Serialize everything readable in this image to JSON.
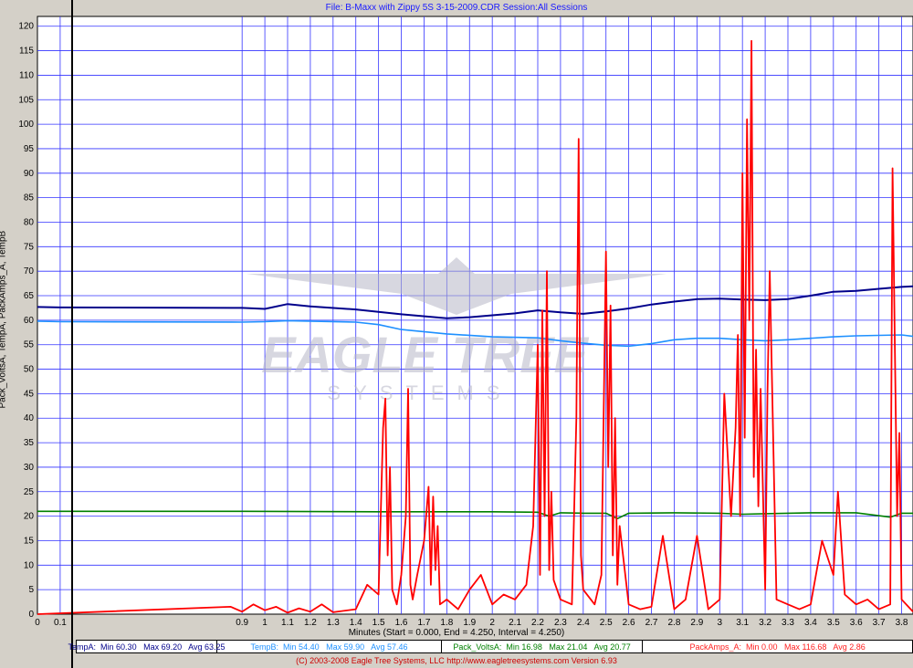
{
  "header": {
    "file_title": "File: B-Maxx with Zippy 5S 3-15-2009.CDR   Session:All Sessions"
  },
  "axes": {
    "ylabel": "Pack_VoltsA, TempA, PackAmps_A, TempB",
    "xlabel": "Minutes (Start = 0.000,  End = 4.250,  Interval = 4.250)"
  },
  "watermark": {
    "line1": "EAGLE TREE",
    "line2": "SYSTEMS"
  },
  "legend": {
    "tempA": "TempA:  Min 60.30   Max 69.20   Avg 63.25",
    "tempB": "TempB:  Min 54.40   Max 59.90   Avg 57.46",
    "volts": "Pack_VoltsA:  Min 16.98   Max 21.04   Avg 20.77",
    "amps": "PackAmps_A:  Min 0.00   Max 116.68   Avg 2.86"
  },
  "footer": {
    "copyright": "(C) 2003-2008 Eagle Tree Systems, LLC     http://www.eagletreesystems.com     Version 6.93"
  },
  "colors": {
    "tempA": "#00008b",
    "tempB": "#1e90ff",
    "volts": "#008000",
    "amps": "#ff0000",
    "grid": "#3333ff",
    "plot_bg": "#ffffff"
  },
  "chart_data": {
    "type": "line",
    "x_unit": "Minutes",
    "xlim": [
      0,
      3.85
    ],
    "ylim": [
      0,
      122
    ],
    "x_ticks": [
      "0",
      "0.1",
      "0.9",
      "1",
      "1.1",
      "1.2",
      "1.3",
      "1.4",
      "1.5",
      "1.6",
      "1.7",
      "1.8",
      "1.9",
      "2",
      "2.1",
      "2.2",
      "2.3",
      "2.4",
      "2.5",
      "2.6",
      "2.7",
      "2.8",
      "2.9",
      "3",
      "3.1",
      "3.2",
      "3.3",
      "3.4",
      "3.5",
      "3.6",
      "3.7",
      "3.8"
    ],
    "y_ticks": [
      0,
      5,
      10,
      15,
      20,
      25,
      30,
      35,
      40,
      45,
      50,
      55,
      60,
      65,
      70,
      75,
      80,
      85,
      90,
      95,
      100,
      105,
      110,
      115,
      120
    ],
    "series": [
      {
        "name": "TempA",
        "x": [
          0.0,
          0.1,
          0.9,
          1.0,
          1.1,
          1.2,
          1.4,
          1.6,
          1.8,
          1.9,
          2.0,
          2.1,
          2.2,
          2.3,
          2.4,
          2.5,
          2.6,
          2.7,
          2.8,
          2.9,
          3.0,
          3.1,
          3.2,
          3.3,
          3.4,
          3.5,
          3.6,
          3.7,
          3.8,
          3.85
        ],
        "y": [
          62.7,
          62.6,
          62.5,
          62.3,
          63.3,
          62.8,
          62.2,
          61.2,
          60.4,
          60.6,
          61.0,
          61.4,
          62.0,
          61.6,
          61.3,
          61.8,
          62.4,
          63.2,
          63.8,
          64.3,
          64.4,
          64.2,
          64.1,
          64.3,
          65.0,
          65.8,
          66.0,
          66.4,
          66.8,
          66.9
        ]
      },
      {
        "name": "TempB",
        "x": [
          0.0,
          0.1,
          0.9,
          1.0,
          1.1,
          1.2,
          1.4,
          1.5,
          1.6,
          1.8,
          2.0,
          2.2,
          2.3,
          2.4,
          2.5,
          2.6,
          2.7,
          2.8,
          2.9,
          3.0,
          3.1,
          3.2,
          3.3,
          3.4,
          3.5,
          3.6,
          3.7,
          3.8,
          3.85
        ],
        "y": [
          59.8,
          59.7,
          59.6,
          59.7,
          59.9,
          59.8,
          59.6,
          59.1,
          58.1,
          57.2,
          56.6,
          56.4,
          55.8,
          55.3,
          54.9,
          54.7,
          55.2,
          56.0,
          56.3,
          56.3,
          56.0,
          55.8,
          56.0,
          56.3,
          56.6,
          56.8,
          56.9,
          57.0,
          56.7
        ]
      },
      {
        "name": "Pack_VoltsA",
        "x": [
          0.0,
          0.9,
          1.5,
          2.0,
          2.2,
          2.25,
          2.3,
          2.4,
          2.5,
          2.55,
          2.6,
          2.8,
          3.0,
          3.1,
          3.2,
          3.4,
          3.6,
          3.75,
          3.8,
          3.85
        ],
        "y": [
          21.0,
          21.0,
          20.9,
          20.9,
          20.8,
          20.0,
          20.7,
          20.6,
          20.6,
          19.5,
          20.6,
          20.7,
          20.6,
          20.4,
          20.5,
          20.7,
          20.7,
          19.8,
          20.6,
          20.6
        ]
      },
      {
        "name": "PackAmps_A",
        "x": [
          0.0,
          0.85,
          0.9,
          0.95,
          1.0,
          1.05,
          1.1,
          1.15,
          1.2,
          1.25,
          1.3,
          1.4,
          1.45,
          1.5,
          1.52,
          1.53,
          1.54,
          1.55,
          1.56,
          1.58,
          1.6,
          1.62,
          1.63,
          1.64,
          1.65,
          1.67,
          1.7,
          1.72,
          1.73,
          1.74,
          1.75,
          1.76,
          1.77,
          1.8,
          1.85,
          1.9,
          1.95,
          2.0,
          2.05,
          2.1,
          2.15,
          2.18,
          2.2,
          2.21,
          2.22,
          2.23,
          2.24,
          2.25,
          2.26,
          2.27,
          2.3,
          2.35,
          2.37,
          2.38,
          2.39,
          2.4,
          2.45,
          2.48,
          2.5,
          2.51,
          2.52,
          2.53,
          2.54,
          2.55,
          2.56,
          2.6,
          2.65,
          2.7,
          2.75,
          2.8,
          2.85,
          2.9,
          2.95,
          3.0,
          3.02,
          3.05,
          3.07,
          3.08,
          3.09,
          3.1,
          3.11,
          3.12,
          3.13,
          3.14,
          3.15,
          3.16,
          3.17,
          3.18,
          3.2,
          3.21,
          3.22,
          3.25,
          3.3,
          3.35,
          3.4,
          3.45,
          3.5,
          3.52,
          3.55,
          3.6,
          3.65,
          3.7,
          3.75,
          3.76,
          3.77,
          3.78,
          3.79,
          3.8,
          3.85
        ],
        "y": [
          0,
          1.5,
          0.5,
          2,
          0.8,
          1.5,
          0.3,
          1.2,
          0.5,
          2,
          0.4,
          1,
          6,
          4,
          38,
          44,
          12,
          30,
          5,
          2,
          8,
          20,
          46,
          6,
          3,
          8,
          15,
          26,
          6,
          24,
          9,
          18,
          2,
          3,
          1,
          5,
          8,
          2,
          4,
          3,
          6,
          18,
          55,
          8,
          62,
          20,
          70,
          9,
          25,
          7,
          3,
          2,
          40,
          97,
          12,
          5,
          2,
          8,
          74,
          30,
          63,
          12,
          40,
          6,
          18,
          2,
          1,
          1.5,
          16,
          1,
          3,
          16,
          1,
          3,
          45,
          20,
          38,
          57,
          20,
          90,
          36,
          101,
          60,
          117,
          28,
          54,
          22,
          46,
          5,
          45,
          70,
          3,
          2,
          1,
          2,
          15,
          8,
          25,
          4,
          2,
          3,
          1,
          2,
          91,
          55,
          20,
          37,
          3,
          0.5
        ]
      }
    ]
  }
}
